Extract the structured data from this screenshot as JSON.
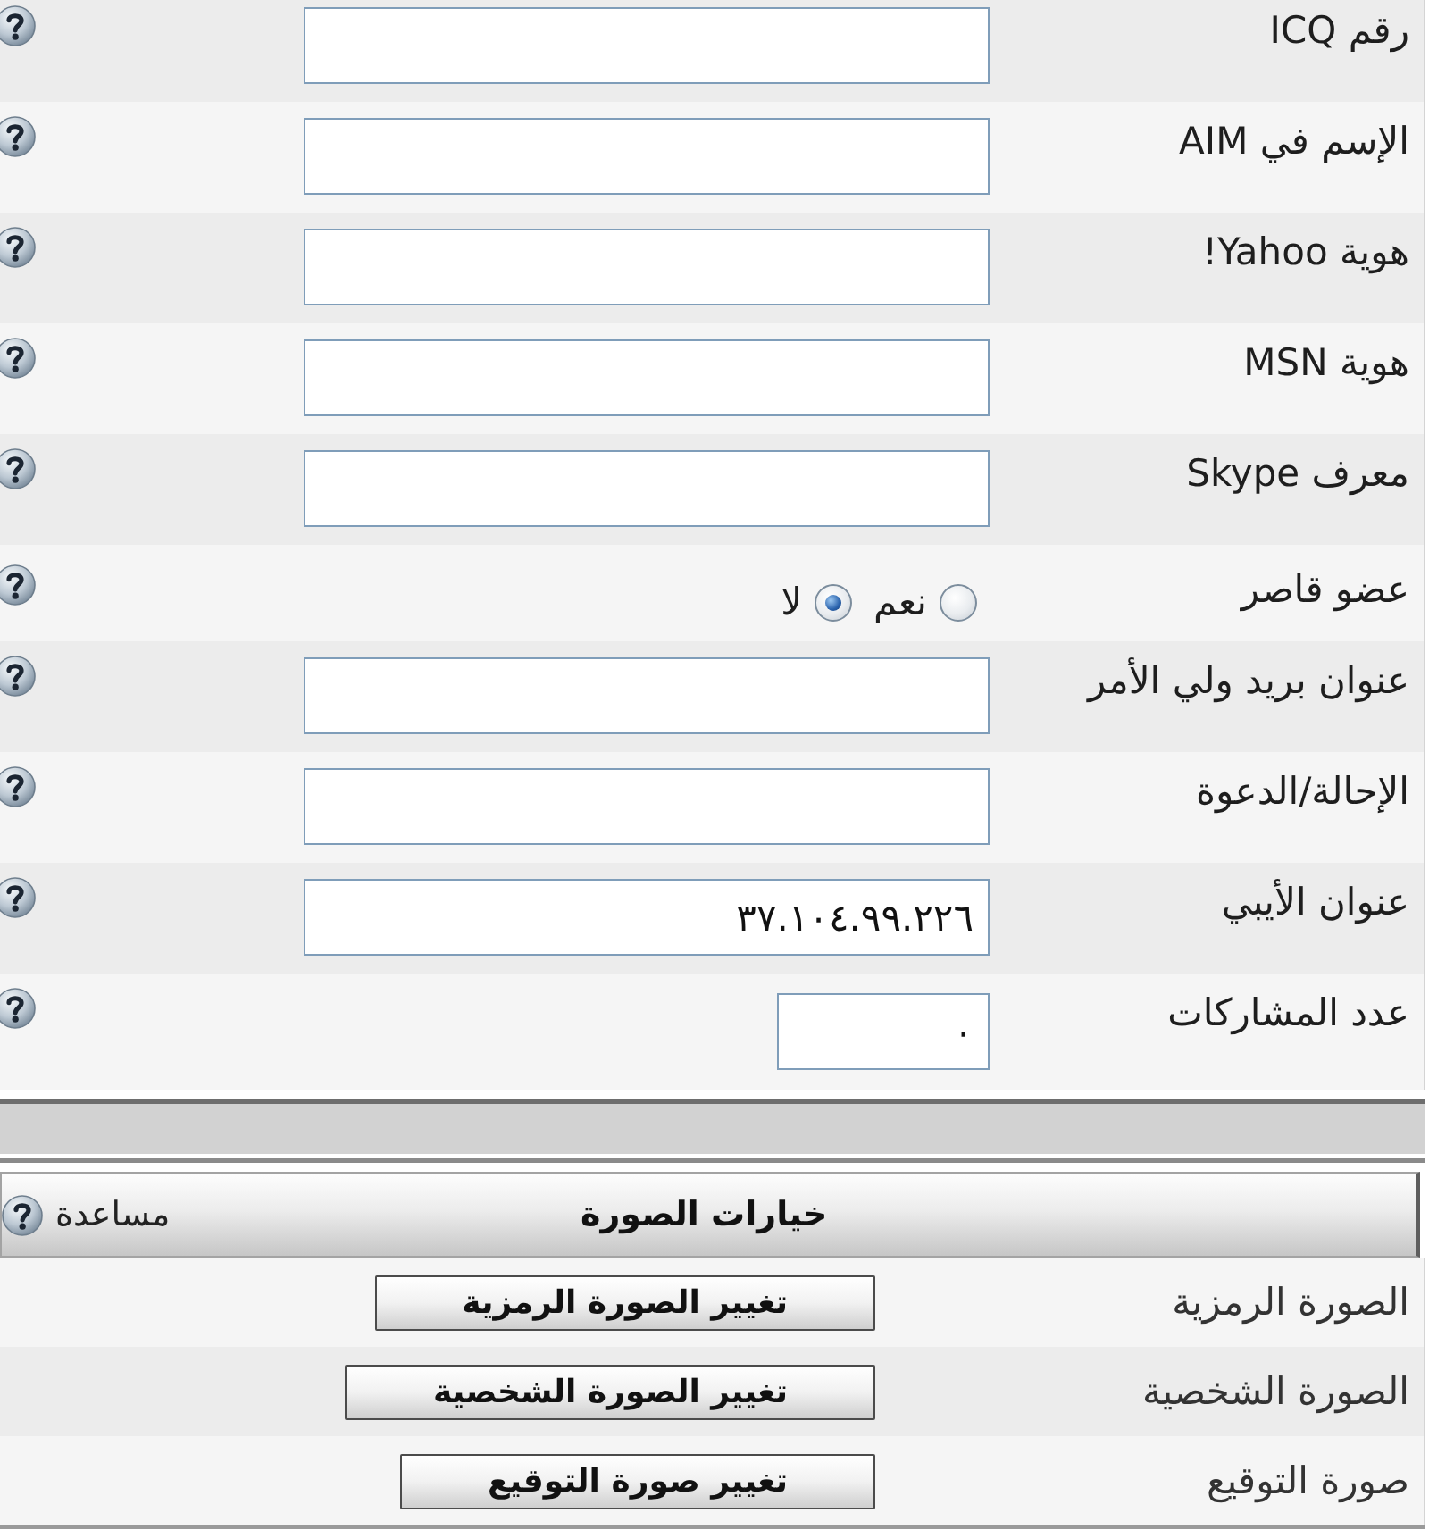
{
  "profile_fields": [
    {
      "kind": "text",
      "label": "رقم ICQ"
    },
    {
      "kind": "text",
      "label": "الإسم في AIM"
    },
    {
      "kind": "text",
      "label": "هوية Yahoo!"
    },
    {
      "kind": "text",
      "label": "هوية MSN"
    },
    {
      "kind": "text",
      "label": "معرف Skype"
    },
    {
      "kind": "radio",
      "label": "عضو قاصر",
      "options": [
        {
          "label": "نعم",
          "selected": false
        },
        {
          "label": "لا",
          "selected": true
        }
      ]
    },
    {
      "kind": "text",
      "label": "عنوان بريد ولي الأمر"
    },
    {
      "kind": "text",
      "label": "الإحالة/الدعوة"
    },
    {
      "kind": "text",
      "label": "عنوان الأيبي",
      "value": "٣٧.١٠٤.٩٩.٢٢٦"
    },
    {
      "kind": "number",
      "label": "عدد المشاركات",
      "value": "٠"
    }
  ],
  "image_options": {
    "title": "خيارات الصورة",
    "help_link": "مساعدة",
    "rows": [
      {
        "label": "الصورة الرمزية",
        "button": "تغيير الصورة الرمزية"
      },
      {
        "label": "الصورة الشخصية",
        "button": "تغيير الصورة الشخصية"
      },
      {
        "label": "صورة التوقيع",
        "button": "تغيير صورة التوقيع"
      }
    ]
  }
}
